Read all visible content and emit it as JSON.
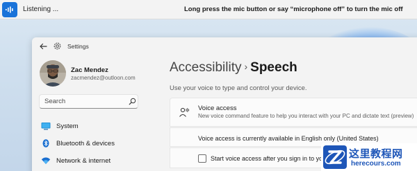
{
  "voice_bar": {
    "status": "Listening ...",
    "hint": "Long press the mic button or say “microphone off” to turn the mic off"
  },
  "window": {
    "app_title": "Settings"
  },
  "profile": {
    "name": "Zac Mendez",
    "email": "zacmendez@outloon.com"
  },
  "search": {
    "placeholder": "Search"
  },
  "nav": {
    "items": [
      {
        "label": "System",
        "icon": "monitor-icon"
      },
      {
        "label": "Bluetooth & devices",
        "icon": "bluetooth-icon"
      },
      {
        "label": "Network & internet",
        "icon": "wifi-icon"
      }
    ]
  },
  "page": {
    "breadcrumb_parent": "Accessibility",
    "breadcrumb_sep": "›",
    "breadcrumb_current": "Speech",
    "subtitle": "Use your voice to type and control your device."
  },
  "voice_access": {
    "title": "Voice access",
    "description": "New voice command feature to help you interact with your PC and dictate text (preview)",
    "availability": "Voice access is currently available in English only (United States)",
    "signin_label": "Start voice access after you sign in to yo"
  },
  "watermark": {
    "main": "这里教程网",
    "url": "herecours.com"
  },
  "colors": {
    "accent": "#1a73d9",
    "watermark": "#1e56b8"
  }
}
